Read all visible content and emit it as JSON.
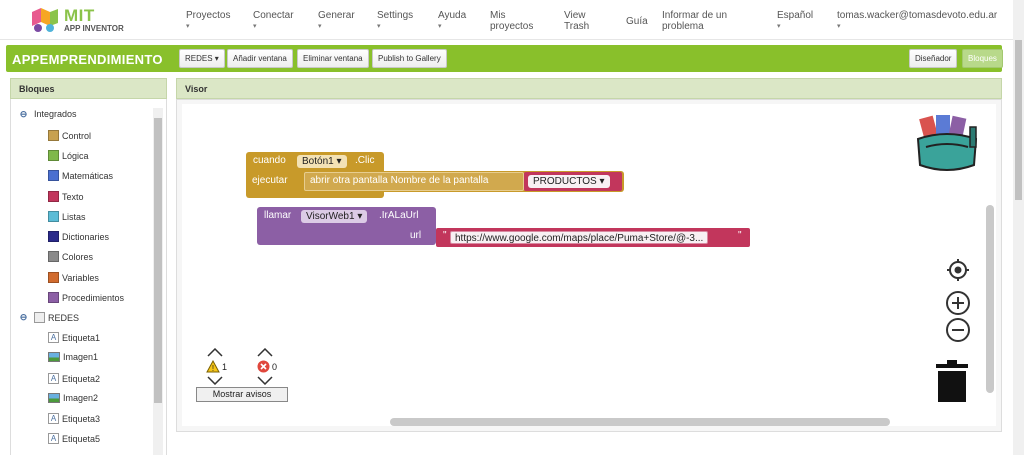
{
  "app": {
    "logo_main": "MIT",
    "logo_sub": "APP INVENTOR",
    "brand_color": "#89c02b"
  },
  "nav": {
    "proyectos": "Proyectos",
    "conectar": "Conectar",
    "generar": "Generar",
    "settings": "Settings",
    "ayuda": "Ayuda",
    "mis_proyectos_1": "Mis",
    "mis_proyectos_2": "proyectos",
    "view_trash_1": "View",
    "view_trash_2": "Trash",
    "guia": "Guía",
    "informar_1": "Informar de un",
    "informar_2": "problema",
    "language": "Español",
    "user": "tomas.wacker@tomasdevoto.edu.ar"
  },
  "appbar": {
    "project_title": "APPEMPRENDIMIENTO",
    "screen_select": "REDES ▾",
    "add_window": "Añadir ventana",
    "remove_window": "Eliminar ventana",
    "publish": "Publish to Gallery",
    "designer": "Diseñador",
    "blocks": "Bloques"
  },
  "panels": {
    "blocks_title": "Bloques",
    "viewer_title": "Visor"
  },
  "tree": {
    "integrated": "Integrados",
    "builtins": [
      {
        "label": "Control",
        "color": "#c8a14f"
      },
      {
        "label": "Lógica",
        "color": "#7fb84a"
      },
      {
        "label": "Matemáticas",
        "color": "#4a6fd0"
      },
      {
        "label": "Texto",
        "color": "#c2365c"
      },
      {
        "label": "Listas",
        "color": "#5bbcd6"
      },
      {
        "label": "Dictionaries",
        "color": "#2a2a8a"
      },
      {
        "label": "Colores",
        "color": "#8a8a8a"
      },
      {
        "label": "Variables",
        "color": "#d16b2e"
      },
      {
        "label": "Procedimientos",
        "color": "#8c5fa5"
      }
    ],
    "screen": "REDES",
    "components": [
      {
        "label": "Etiqueta1",
        "icon": "label-icon"
      },
      {
        "label": "Imagen1",
        "icon": "image-icon"
      },
      {
        "label": "Etiqueta2",
        "icon": "label-icon"
      },
      {
        "label": "Imagen2",
        "icon": "image-icon"
      },
      {
        "label": "Etiqueta3",
        "icon": "label-icon"
      },
      {
        "label": "Etiqueta5",
        "icon": "label-icon"
      }
    ]
  },
  "blocks": {
    "when": "cuando",
    "button": "Botón1 ▾",
    "click": ".Clic",
    "do": "ejecutar",
    "open_screen": "abrir otra pantalla  Nombre de la pantalla",
    "screen_value": "PRODUCTOS ▾",
    "call": "llamar",
    "webviewer": "VisorWeb1 ▾",
    "goto_url": ".IrALaUrl",
    "url_label": "url",
    "url_value": "https://www.google.com/maps/place/Puma+Store/@-3..."
  },
  "warnings": {
    "warning_count": "1",
    "error_count": "0",
    "show_label": "Mostrar avisos"
  }
}
